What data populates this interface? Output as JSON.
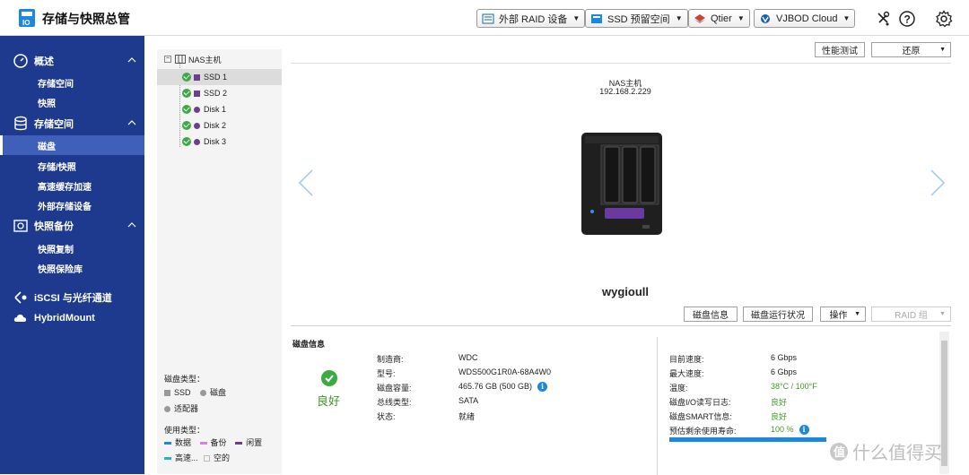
{
  "app": {
    "title": "存储与快照总管"
  },
  "toolbar": {
    "external_raid": "外部 RAID 设备",
    "ssd_reserve": "SSD 预留空间",
    "qtier": "Qtier",
    "vjbod": "VJBOD Cloud"
  },
  "sidebar": {
    "groups": [
      {
        "label": "概述",
        "items": [
          "存储空间",
          "快照"
        ]
      },
      {
        "label": "存储空间",
        "items": [
          "磁盘",
          "存储/快照",
          "高速缓存加速",
          "外部存储设备"
        ]
      },
      {
        "label": "快照备份",
        "items": [
          "快照复制",
          "快照保险库"
        ]
      }
    ],
    "iscsi": "iSCSI 与光纤通道",
    "hybridmount": "HybridMount",
    "active_item": "磁盘"
  },
  "tree": {
    "root": "NAS主机",
    "disks": [
      "SSD 1",
      "SSD 2",
      "Disk 1",
      "Disk 2",
      "Disk 3"
    ]
  },
  "legend": {
    "disk_type_title": "磁盘类型：",
    "ssd": "SSD",
    "hdd": "磁盘",
    "adapter": "适配器",
    "usage_title": "使用类型：",
    "data": "数据",
    "backup": "备份",
    "idle": "闲置",
    "cache": "高速...",
    "empty": "空的"
  },
  "main": {
    "perf_test": "性能测试",
    "restore": "还原",
    "nas_label": "NAS主机",
    "nas_ip": "192.168.2.229",
    "hostname": "wygioull",
    "disk_info_btn": "磁盘信息",
    "disk_status_btn": "磁盘运行状况",
    "action_btn": "操作",
    "raid_group_btn": "RAID 组"
  },
  "info": {
    "title": "磁盘信息",
    "status": "良好",
    "left": [
      {
        "k": "制造商:",
        "v": "WDC"
      },
      {
        "k": "型号:",
        "v": "WDS500G1R0A-68A4W0"
      },
      {
        "k": "磁盘容量:",
        "v": "465.76 GB (500 GB)"
      },
      {
        "k": "总线类型:",
        "v": "SATA"
      },
      {
        "k": "状态:",
        "v": "就绪"
      }
    ],
    "right": [
      {
        "k": "目前速度:",
        "v": "6 Gbps"
      },
      {
        "k": "最大速度:",
        "v": "6 Gbps"
      },
      {
        "k": "温度:",
        "v": "38°C / 100°F"
      },
      {
        "k": "磁盘I/O读写日志:",
        "v": "良好"
      },
      {
        "k": "磁盘SMART信息:",
        "v": "良好"
      },
      {
        "k": "预估剩余使用寿命:",
        "v": "100 %"
      }
    ],
    "life_percent": 100
  },
  "watermark": "什么值得买",
  "colors": {
    "sidebar": "#1e3a8e",
    "accent": "#1a87e0",
    "good": "#3d9a27",
    "disk": "#6b3f8c"
  }
}
